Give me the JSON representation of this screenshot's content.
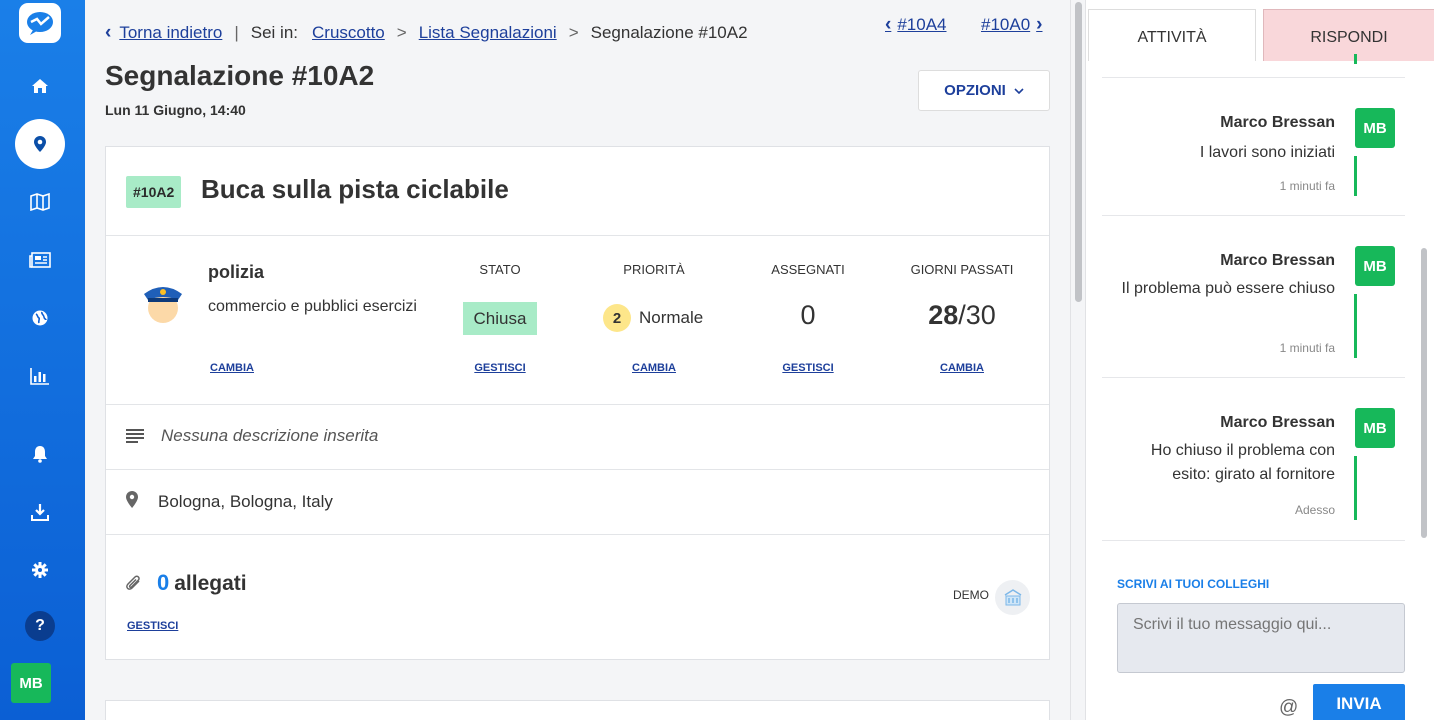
{
  "sidebar": {
    "avatar": "MB",
    "help": "?",
    "icons": [
      "logo-icon",
      "home-icon",
      "location-pin-icon",
      "map-icon",
      "newspaper-icon",
      "globe-icon",
      "bar-chart-icon",
      "bell-icon",
      "download-icon",
      "gear-icon"
    ]
  },
  "breadcrumb": {
    "back": "Torna indietro",
    "divider": "|",
    "sei_in": "Sei in:",
    "sep": ">",
    "items": [
      "Cruscotto",
      "Lista Segnalazioni",
      "Segnalazione #10A2"
    ]
  },
  "nav": {
    "prev": "#10A4",
    "next": "#10A0"
  },
  "header": {
    "title": "Segnalazione #10A2",
    "date": "Lun 11 Giugno, 14:40",
    "options": "OPZIONI"
  },
  "report": {
    "tag": "#10A2",
    "title": "Buca sulla pista ciclabile",
    "category": {
      "name": "polizia",
      "sub": "commercio e pubblici esercizi",
      "link": "CAMBIA"
    },
    "stato": {
      "label": "STATO",
      "value": "Chiusa",
      "link": "GESTISCI"
    },
    "priorita": {
      "label": "PRIORITÀ",
      "level": "2",
      "value": "Normale",
      "link": "CAMBIA"
    },
    "assegnati": {
      "label": "ASSEGNATI",
      "value": "0",
      "link": "GESTISCI"
    },
    "giorni": {
      "label": "GIORNI PASSATI",
      "passed": "28",
      "total": "/30",
      "link": "CAMBIA"
    },
    "description": "Nessuna descrizione inserita",
    "location": "Bologna, Bologna, Italy",
    "attachments": {
      "count": "0",
      "label": "allegati",
      "link": "GESTISCI"
    },
    "demo": "DEMO"
  },
  "panel": {
    "tabs": [
      "ATTIVITÀ",
      "RISPONDI"
    ],
    "activities": [
      {
        "author": "Marco Bressan",
        "text": "I lavori sono iniziati",
        "time": "1 minuti fa",
        "avatar": "MB"
      },
      {
        "author": "Marco Bressan",
        "text": "Il problema può essere chiuso",
        "time": "1 minuti fa",
        "avatar": "MB"
      },
      {
        "author": "Marco Bressan",
        "text": "Ho chiuso il problema con esito: girato al fornitore",
        "time": "Adesso",
        "avatar": "MB"
      }
    ],
    "write_label": "SCRIVI AI TUOI COLLEGHI",
    "placeholder": "Scrivi il tuo messaggio qui...",
    "at": "@",
    "send": "INVIA"
  },
  "colors": {
    "brand": "#1a7fe8",
    "green": "#17b85a",
    "link": "#1d3f9b",
    "tag_bg": "#a8ebc7",
    "rispondi_bg": "#f9d7da"
  }
}
